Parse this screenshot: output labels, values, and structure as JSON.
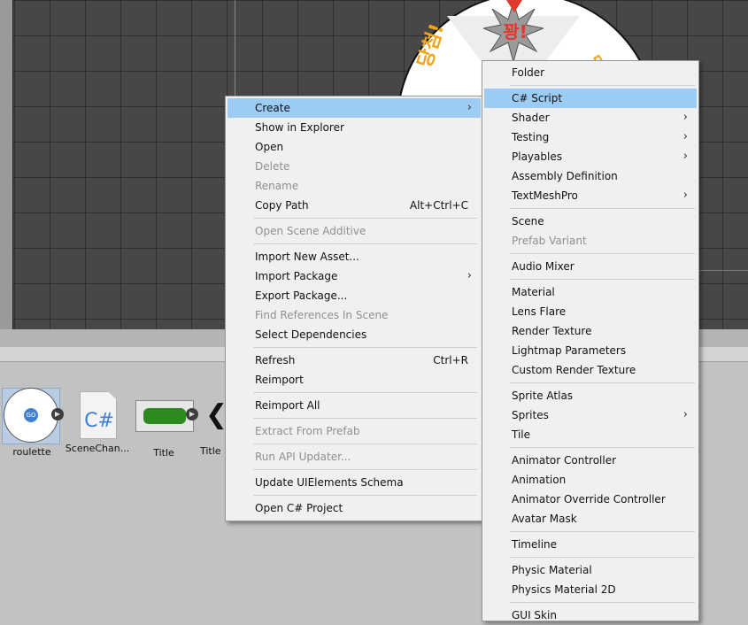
{
  "scene": {
    "roulette_top_text": "꽝!",
    "roulette_left_text": "당첨!",
    "roulette_right_text": "당"
  },
  "assets": [
    {
      "label": "roulette",
      "thumb_text": "GO"
    },
    {
      "label": "SceneChan...",
      "thumb_text": "C#"
    },
    {
      "label": "Title",
      "thumb_text": ""
    },
    {
      "label": "Title",
      "thumb_text": ""
    }
  ],
  "context_menu": {
    "items": [
      {
        "label": "Create",
        "submenu": true,
        "highlighted": true
      },
      {
        "label": "Show in Explorer"
      },
      {
        "label": "Open"
      },
      {
        "label": "Delete",
        "disabled": true
      },
      {
        "label": "Rename",
        "disabled": true
      },
      {
        "label": "Copy Path",
        "shortcut": "Alt+Ctrl+C"
      },
      {
        "label": "Open Scene Additive",
        "disabled": true
      },
      {
        "label": "Import New Asset..."
      },
      {
        "label": "Import Package",
        "submenu": true
      },
      {
        "label": "Export Package..."
      },
      {
        "label": "Find References In Scene",
        "disabled": true
      },
      {
        "label": "Select Dependencies"
      },
      {
        "label": "Refresh",
        "shortcut": "Ctrl+R"
      },
      {
        "label": "Reimport"
      },
      {
        "label": "Reimport All"
      },
      {
        "label": "Extract From Prefab",
        "disabled": true
      },
      {
        "label": "Run API Updater...",
        "disabled": true
      },
      {
        "label": "Update UIElements Schema"
      },
      {
        "label": "Open C# Project"
      }
    ]
  },
  "create_submenu": {
    "items": [
      {
        "label": "Folder"
      },
      {
        "label": "C# Script",
        "highlighted": true
      },
      {
        "label": "Shader",
        "submenu": true
      },
      {
        "label": "Testing",
        "submenu": true
      },
      {
        "label": "Playables",
        "submenu": true
      },
      {
        "label": "Assembly Definition"
      },
      {
        "label": "TextMeshPro",
        "submenu": true
      },
      {
        "label": "Scene"
      },
      {
        "label": "Prefab Variant",
        "disabled": true
      },
      {
        "label": "Audio Mixer"
      },
      {
        "label": "Material"
      },
      {
        "label": "Lens Flare"
      },
      {
        "label": "Render Texture"
      },
      {
        "label": "Lightmap Parameters"
      },
      {
        "label": "Custom Render Texture"
      },
      {
        "label": "Sprite Atlas"
      },
      {
        "label": "Sprites",
        "submenu": true
      },
      {
        "label": "Tile"
      },
      {
        "label": "Animator Controller"
      },
      {
        "label": "Animation"
      },
      {
        "label": "Animator Override Controller"
      },
      {
        "label": "Avatar Mask"
      },
      {
        "label": "Timeline"
      },
      {
        "label": "Physic Material"
      },
      {
        "label": "Physics Material 2D"
      },
      {
        "label": "GUI Skin"
      }
    ]
  },
  "colors": {
    "highlight": "#9ccbf3",
    "scene_bg": "#474747",
    "menu_bg": "#f0f0f0",
    "disabled_text": "#8f8f8f"
  }
}
